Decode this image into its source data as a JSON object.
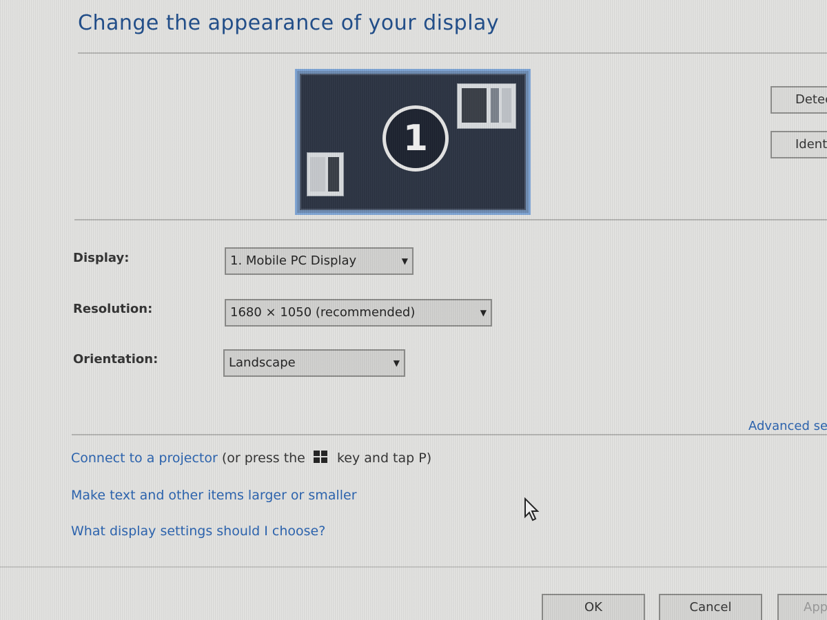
{
  "dialog": {
    "title": "Change the appearance of your display"
  },
  "monitor_preview": {
    "number": "1"
  },
  "side_buttons": {
    "detect_label": "Detect",
    "identify_label": "Identify"
  },
  "settings": {
    "display": {
      "label": "Display:",
      "value": "1. Mobile PC Display"
    },
    "resolution": {
      "label": "Resolution:",
      "value": "1680 × 1050 (recommended)"
    },
    "orientation": {
      "label": "Orientation:",
      "value": "Landscape"
    }
  },
  "advanced_settings_label": "Advanced settings",
  "links": {
    "projector_link": "Connect to a projector",
    "projector_hint_prefix": " (or press the ",
    "projector_hint_suffix": " key and tap P)",
    "text_size": "Make text and other items larger or smaller",
    "help": "What display settings should I choose?"
  },
  "buttons": {
    "ok": "OK",
    "cancel": "Cancel",
    "apply": "Apply"
  },
  "colors": {
    "link": "#2a63b0",
    "title": "#1f4d8a",
    "background": "#e3e3e1"
  }
}
